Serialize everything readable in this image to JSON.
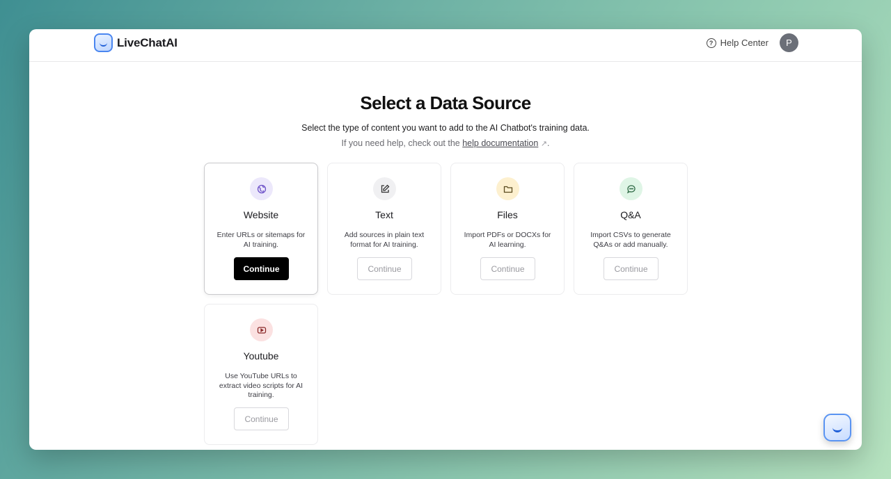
{
  "app": {
    "name": "LiveChatAI"
  },
  "header": {
    "help_label": "Help Center",
    "avatar_initial": "P"
  },
  "main": {
    "title": "Select a Data Source",
    "subtitle": "Select the type of content you want to add to the AI Chatbot's training data.",
    "help_prefix": "If you need help, check out the",
    "help_link": "help documentation",
    "help_suffix": "."
  },
  "sources": [
    {
      "title": "Website",
      "description": "Enter URLs or sitemaps for AI training.",
      "button": "Continue",
      "icon": "globe-icon",
      "icon_bg": "#ece8fb",
      "icon_color": "#6b4fc7",
      "selected": true
    },
    {
      "title": "Text",
      "description": "Add sources in plain text format for AI training.",
      "button": "Continue",
      "icon": "edit-icon",
      "icon_bg": "#f0f0f2",
      "icon_color": "#333333",
      "selected": false
    },
    {
      "title": "Files",
      "description": "Import PDFs or DOCXs for AI learning.",
      "button": "Continue",
      "icon": "folder-icon",
      "icon_bg": "#fdf0cf",
      "icon_color": "#5a4a1f",
      "selected": false
    },
    {
      "title": "Q&A",
      "description": "Import CSVs to generate Q&As or add manually.",
      "button": "Continue",
      "icon": "chat-icon",
      "icon_bg": "#dff5e6",
      "icon_color": "#2f6a45",
      "selected": false
    },
    {
      "title": "Youtube",
      "description": "Use YouTube URLs to extract video scripts for AI training.",
      "button": "Continue",
      "icon": "video-icon",
      "icon_bg": "#fbe1e1",
      "icon_color": "#8a2a2a",
      "selected": false
    }
  ]
}
